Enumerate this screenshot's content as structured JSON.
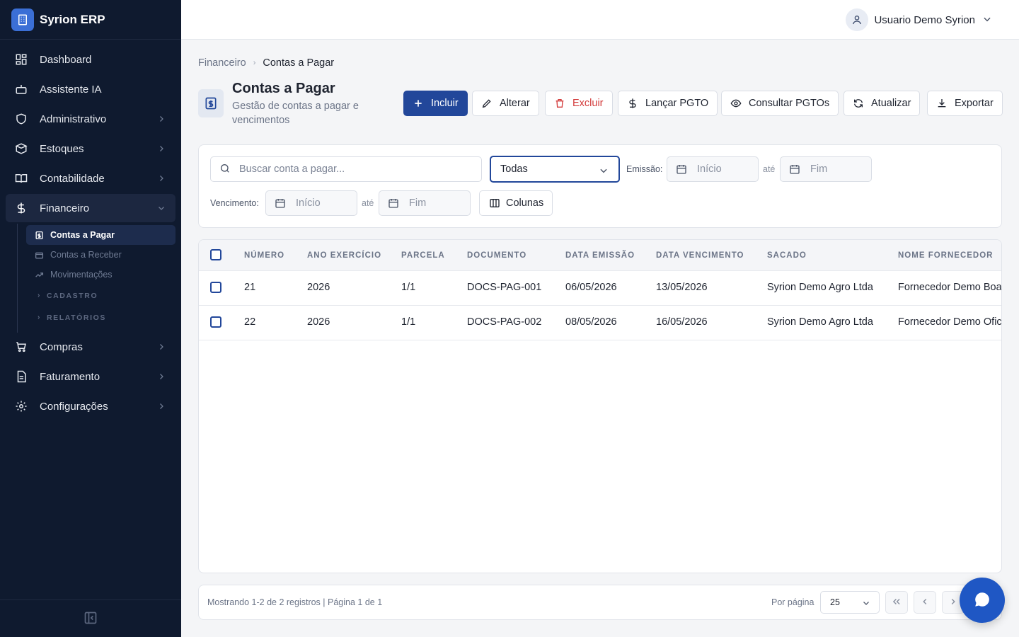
{
  "app": {
    "name": "Syrion ERP"
  },
  "sidebar": {
    "items": [
      {
        "label": "Dashboard",
        "icon": "dashboard-icon"
      },
      {
        "label": "Assistente IA",
        "icon": "bot-icon"
      },
      {
        "label": "Administrativo",
        "icon": "shield-icon"
      },
      {
        "label": "Estoques",
        "icon": "box-icon"
      },
      {
        "label": "Contabilidade",
        "icon": "book-icon"
      },
      {
        "label": "Financeiro",
        "icon": "dollar-icon",
        "active": true
      },
      {
        "label": "Compras",
        "icon": "cart-icon"
      },
      {
        "label": "Faturamento",
        "icon": "file-icon"
      },
      {
        "label": "Configurações",
        "icon": "gear-icon"
      }
    ],
    "financeiro_sub": [
      {
        "label": "Contas a Pagar",
        "active": true
      },
      {
        "label": "Contas a Receber"
      },
      {
        "label": "Movimentações"
      }
    ],
    "financeiro_groups": [
      "CADASTRO",
      "RELATÓRIOS"
    ]
  },
  "topbar": {
    "user_name": "Usuario Demo Syrion"
  },
  "breadcrumb": {
    "parent": "Financeiro",
    "current": "Contas a Pagar"
  },
  "page": {
    "title": "Contas a Pagar",
    "subtitle": "Gestão de contas a pagar e vencimentos"
  },
  "toolbar": {
    "incluir": "Incluir",
    "alterar": "Alterar",
    "excluir": "Excluir",
    "lancar": "Lançar PGTO",
    "consultar": "Consultar PGTOs",
    "atualizar": "Atualizar",
    "exportar": "Exportar"
  },
  "filters": {
    "search_placeholder": "Buscar conta a pagar...",
    "status_value": "Todas",
    "emissao_label": "Emissão:",
    "vencimento_label": "Vencimento:",
    "start_placeholder": "Início",
    "end_placeholder": "Fim",
    "ate": "até",
    "colunas": "Colunas"
  },
  "table": {
    "headers": [
      "NÚMERO",
      "ANO EXERCÍCIO",
      "PARCELA",
      "DOCUMENTO",
      "DATA EMISSÃO",
      "DATA VENCIMENTO",
      "SACADO",
      "NOME FORNECEDOR"
    ],
    "rows": [
      [
        "21",
        "2026",
        "1/1",
        "DOCS-PAG-001",
        "06/05/2026",
        "13/05/2026",
        "Syrion Demo Agro Ltda",
        "Fornecedor Demo Boa"
      ],
      [
        "22",
        "2026",
        "1/1",
        "DOCS-PAG-002",
        "08/05/2026",
        "16/05/2026",
        "Syrion Demo Agro Ltda",
        "Fornecedor Demo Ofic"
      ]
    ]
  },
  "footer": {
    "info": "Mostrando 1-2 de 2 registros | Página 1 de 1",
    "per_page_label": "Por página",
    "per_page_value": "25"
  },
  "colors": {
    "primary": "#22479a",
    "sidebar_bg": "#0f1a2f",
    "danger": "#d33b3b",
    "fab": "#1f57c4"
  }
}
